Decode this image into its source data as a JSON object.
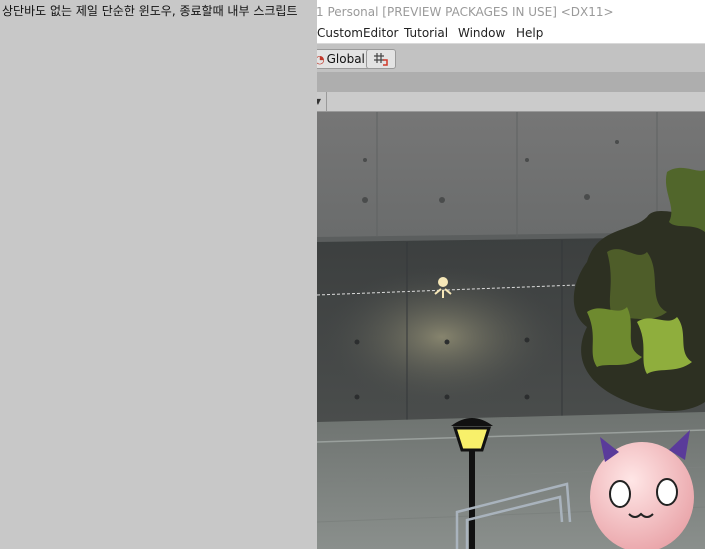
{
  "unity_window": {
    "title": "1 Personal [PREVIEW PACKAGES IN USE] <DX11>",
    "menu": [
      "CustomEditor",
      "Tutorial",
      "Window",
      "Help"
    ],
    "toolbar": {
      "global_button_label": "Global",
      "global_icon": "pivot-icon",
      "grid_button_icon": "grid-snap-icon"
    }
  },
  "overlay_window": {
    "title": "상단바도 없는 제일 단순한 윈도우, 종료할때 내부 스크립트"
  }
}
